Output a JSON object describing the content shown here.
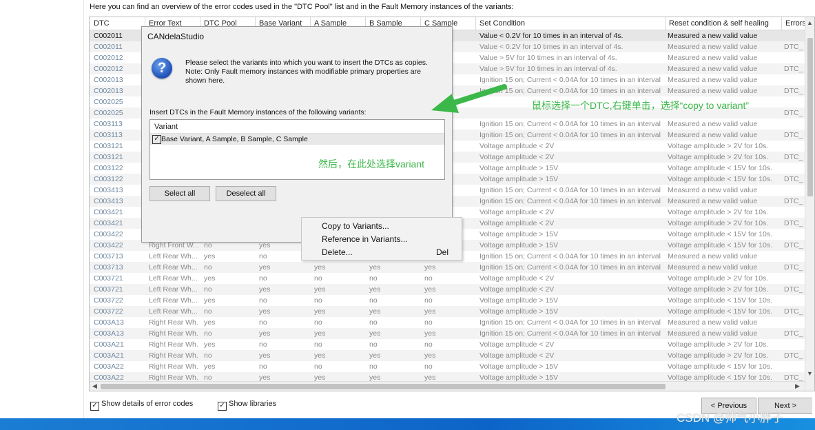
{
  "intro_text": "Here you can find an overview of the error codes used in the \"DTC Pool\" list and in the Fault Memory instances of the variants:",
  "columns": [
    "DTC",
    "Error Text",
    "DTC Pool",
    "Base Variant",
    "A Sample",
    "B Sample",
    "C Sample",
    "Set Condition",
    "Reset condition & self healing",
    "Errors"
  ],
  "rows": [
    {
      "dtc": "C002011",
      "err": "",
      "pool": "",
      "base": "",
      "a": "",
      "b": "",
      "c": "",
      "set": "Value < 0.2V for 10 times in an interval of 4s.",
      "reset": "Measured a new valid value",
      "e": ""
    },
    {
      "dtc": "C002011",
      "err": "",
      "pool": "",
      "base": "",
      "a": "",
      "b": "",
      "c": "",
      "set": "Value < 0.2V for 10 times in an interval of 4s.",
      "reset": "Measured a new valid value",
      "e": "DTC_"
    },
    {
      "dtc": "C002012",
      "err": "",
      "pool": "",
      "base": "",
      "a": "",
      "b": "",
      "c": "",
      "set": "Value > 5V for 10 times in an interval of 4s.",
      "reset": "Measured a new valid value",
      "e": ""
    },
    {
      "dtc": "C002012",
      "err": "",
      "pool": "",
      "base": "",
      "a": "",
      "b": "",
      "c": "",
      "set": "Value > 5V for 10 times in an interval of 4s.",
      "reset": "Measured a new valid value",
      "e": "DTC_"
    },
    {
      "dtc": "C002013",
      "err": "",
      "pool": "",
      "base": "",
      "a": "",
      "b": "",
      "c": "",
      "set": "Ignition 15 on; Current < 0.04A for 10 times in an interval ...",
      "reset": "Measured a new valid value",
      "e": ""
    },
    {
      "dtc": "C002013",
      "err": "",
      "pool": "",
      "base": "",
      "a": "",
      "b": "",
      "c": "",
      "set": "Ignition 15 on; Current < 0.04A for 10 times in an interval ...",
      "reset": "Measured a new valid value",
      "e": "DTC_"
    },
    {
      "dtc": "C002025",
      "err": "",
      "pool": "",
      "base": "",
      "a": "",
      "b": "",
      "c": "",
      "set": "",
      "reset": "",
      "e": ""
    },
    {
      "dtc": "C002025",
      "err": "",
      "pool": "",
      "base": "",
      "a": "",
      "b": "",
      "c": "",
      "set": "",
      "reset": "",
      "e": "DTC_"
    },
    {
      "dtc": "C003113",
      "err": "",
      "pool": "",
      "base": "",
      "a": "",
      "b": "",
      "c": "",
      "set": "Ignition 15 on; Current < 0.04A for 10 times in an interval ...",
      "reset": "Measured a new valid value",
      "e": ""
    },
    {
      "dtc": "C003113",
      "err": "",
      "pool": "",
      "base": "",
      "a": "",
      "b": "",
      "c": "",
      "set": "Ignition 15 on; Current < 0.04A for 10 times in an interval ...",
      "reset": "Measured a new valid value",
      "e": "DTC_"
    },
    {
      "dtc": "C003121",
      "err": "",
      "pool": "",
      "base": "",
      "a": "",
      "b": "",
      "c": "",
      "set": "Voltage amplitude < 2V",
      "reset": "Voltage amplitude > 2V for 10s.",
      "e": ""
    },
    {
      "dtc": "C003121",
      "err": "",
      "pool": "",
      "base": "",
      "a": "",
      "b": "",
      "c": "",
      "set": "Voltage amplitude < 2V",
      "reset": "Voltage amplitude > 2V for 10s.",
      "e": "DTC_"
    },
    {
      "dtc": "C003122",
      "err": "",
      "pool": "",
      "base": "",
      "a": "",
      "b": "",
      "c": "",
      "set": "Voltage amplitude > 15V",
      "reset": "Voltage amplitude < 15V for 10s.",
      "e": ""
    },
    {
      "dtc": "C003122",
      "err": "",
      "pool": "",
      "base": "",
      "a": "",
      "b": "",
      "c": "",
      "set": "Voltage amplitude > 15V",
      "reset": "Voltage amplitude < 15V for 10s.",
      "e": "DTC_"
    },
    {
      "dtc": "C003413",
      "err": "",
      "pool": "",
      "base": "",
      "a": "",
      "b": "",
      "c": "",
      "set": "Ignition 15 on; Current < 0.04A for 10 times in an interval ...",
      "reset": "Measured a new valid value",
      "e": ""
    },
    {
      "dtc": "C003413",
      "err": "",
      "pool": "",
      "base": "",
      "a": "",
      "b": "",
      "c": "",
      "set": "Ignition 15 on; Current < 0.04A for 10 times in an interval ...",
      "reset": "Measured a new valid value",
      "e": "DTC_"
    },
    {
      "dtc": "C003421",
      "err": "",
      "pool": "",
      "base": "",
      "a": "",
      "b": "",
      "c": "",
      "set": "Voltage amplitude < 2V",
      "reset": "Voltage amplitude > 2V for 10s.",
      "e": ""
    },
    {
      "dtc": "C003421",
      "err": "",
      "pool": "",
      "base": "",
      "a": "",
      "b": "",
      "c": "",
      "set": "Voltage amplitude < 2V",
      "reset": "Voltage amplitude > 2V for 10s.",
      "e": "DTC_"
    },
    {
      "dtc": "C003422",
      "err": "",
      "pool": "",
      "base": "",
      "a": "",
      "b": "",
      "c": "",
      "set": "Voltage amplitude > 15V",
      "reset": "Voltage amplitude < 15V for 10s.",
      "e": ""
    },
    {
      "dtc": "C003422",
      "err": "Right Front W...",
      "pool": "no",
      "base": "yes",
      "a": "",
      "b": "",
      "c": "",
      "set": "Voltage amplitude > 15V",
      "reset": "Voltage amplitude < 15V for 10s.",
      "e": "DTC_"
    },
    {
      "dtc": "C003713",
      "err": "Left Rear Wh...",
      "pool": "yes",
      "base": "no",
      "a": "",
      "b": "",
      "c": "",
      "set": "Ignition 15 on; Current < 0.04A for 10 times in an interval ...",
      "reset": "Measured a new valid value",
      "e": ""
    },
    {
      "dtc": "C003713",
      "err": "Left Rear Wh...",
      "pool": "no",
      "base": "yes",
      "a": "yes",
      "b": "yes",
      "c": "yes",
      "set": "Ignition 15 on; Current < 0.04A for 10 times in an interval ...",
      "reset": "Measured a new valid value",
      "e": "DTC_"
    },
    {
      "dtc": "C003721",
      "err": "Left Rear Wh...",
      "pool": "yes",
      "base": "no",
      "a": "no",
      "b": "no",
      "c": "no",
      "set": "Voltage amplitude < 2V",
      "reset": "Voltage amplitude > 2V for 10s.",
      "e": ""
    },
    {
      "dtc": "C003721",
      "err": "Left Rear Wh...",
      "pool": "no",
      "base": "yes",
      "a": "yes",
      "b": "yes",
      "c": "yes",
      "set": "Voltage amplitude < 2V",
      "reset": "Voltage amplitude > 2V for 10s.",
      "e": "DTC_"
    },
    {
      "dtc": "C003722",
      "err": "Left Rear Wh...",
      "pool": "yes",
      "base": "no",
      "a": "no",
      "b": "no",
      "c": "no",
      "set": "Voltage amplitude > 15V",
      "reset": "Voltage amplitude < 15V for 10s.",
      "e": ""
    },
    {
      "dtc": "C003722",
      "err": "Left Rear Wh...",
      "pool": "no",
      "base": "yes",
      "a": "yes",
      "b": "yes",
      "c": "yes",
      "set": "Voltage amplitude > 15V",
      "reset": "Voltage amplitude < 15V for 10s.",
      "e": "DTC_"
    },
    {
      "dtc": "C003A13",
      "err": "Right Rear Wh...",
      "pool": "yes",
      "base": "no",
      "a": "no",
      "b": "no",
      "c": "no",
      "set": "Ignition 15 on; Current < 0.04A for 10 times in an interval ...",
      "reset": "Measured a new valid value",
      "e": ""
    },
    {
      "dtc": "C003A13",
      "err": "Right Rear Wh...",
      "pool": "no",
      "base": "yes",
      "a": "yes",
      "b": "yes",
      "c": "yes",
      "set": "Ignition 15 on; Current < 0.04A for 10 times in an interval ...",
      "reset": "Measured a new valid value",
      "e": "DTC_"
    },
    {
      "dtc": "C003A21",
      "err": "Right Rear Wh...",
      "pool": "yes",
      "base": "no",
      "a": "no",
      "b": "no",
      "c": "no",
      "set": "Voltage amplitude < 2V",
      "reset": "Voltage amplitude > 2V for 10s.",
      "e": ""
    },
    {
      "dtc": "C003A21",
      "err": "Right Rear Wh...",
      "pool": "no",
      "base": "yes",
      "a": "yes",
      "b": "yes",
      "c": "yes",
      "set": "Voltage amplitude < 2V",
      "reset": "Voltage amplitude > 2V for 10s.",
      "e": "DTC_"
    },
    {
      "dtc": "C003A22",
      "err": "Right Rear Wh...",
      "pool": "yes",
      "base": "no",
      "a": "no",
      "b": "no",
      "c": "no",
      "set": "Voltage amplitude > 15V",
      "reset": "Voltage amplitude < 15V for 10s.",
      "e": ""
    },
    {
      "dtc": "C003A22",
      "err": "Right Rear Wh...",
      "pool": "no",
      "base": "yes",
      "a": "yes",
      "b": "yes",
      "c": "yes",
      "set": "Voltage amplitude > 15V",
      "reset": "Voltage amplitude < 15V for 10s.",
      "e": "DTC_"
    }
  ],
  "options": {
    "show_details": "Show details of error codes",
    "show_libraries": "Show libraries"
  },
  "nav": {
    "previous": "< Previous",
    "next": "Next >"
  },
  "dialog": {
    "title": "CANdelaStudio",
    "message_line1": "Please select the variants into which you want to insert the DTCs as copies.",
    "message_line2": "Note: Only Fault memory instances with modifiable primary properties are",
    "message_line3": "shown here.",
    "insert_label": "Insert DTCs in the Fault Memory instances of the following variants:",
    "list_header": "Variant",
    "variant_item": "Base Variant, A Sample, B Sample, C Sample",
    "select_all": "Select all",
    "deselect_all": "Deselect all"
  },
  "context_menu": {
    "copy": "Copy to Variants...",
    "reference": "Reference in Variants...",
    "delete": "Delete...",
    "delete_shortcut": "Del"
  },
  "annotations": {
    "note1": "鼠标选择一个DTC,右键单击，选择“copy to variant”",
    "note2": "然后，在此处选择variant"
  },
  "watermark": "CSDN @帅气小胖子",
  "colors": {
    "annotation": "#3cb84a",
    "taskbar": "#0d64c8"
  }
}
